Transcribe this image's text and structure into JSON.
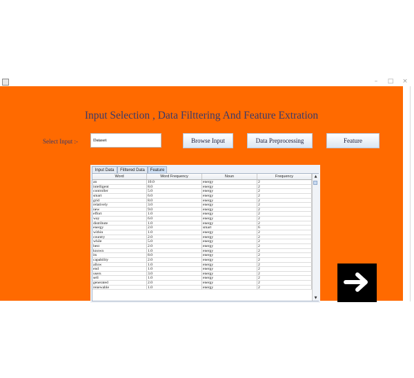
{
  "window": {
    "minimize": "–",
    "maximize": "□",
    "close": "×"
  },
  "heading": "Input Selection , Data Filttering And Feature Extration",
  "select_label": "Select Input  :-",
  "dataset_value": "Dataset",
  "buttons": {
    "browse": "Browse Input",
    "preprocess": "Data Preprocessing",
    "feature": "Feature"
  },
  "tabs": [
    "Input Data",
    "Filltered Data",
    "Feature"
  ],
  "table": {
    "columns": [
      "Word",
      "Word Frequency",
      "Noun",
      "Frequency"
    ],
    "rows": [
      [
        "an",
        "10.0",
        "energy",
        "2"
      ],
      [
        "intelligent",
        "8.0",
        "energy",
        "2"
      ],
      [
        "controller",
        "5.0",
        "energy",
        "2"
      ],
      [
        "smart",
        "6.0",
        "energy",
        "2"
      ],
      [
        "grid",
        "8.0",
        "energy",
        "2"
      ],
      [
        "relatively",
        "3.0",
        "energy",
        "2"
      ],
      [
        "new",
        "9.0",
        "energy",
        "2"
      ],
      [
        "effort",
        "1.0",
        "energy",
        "2"
      ],
      [
        "way",
        "6.0",
        "energy",
        "2"
      ],
      [
        "distribute",
        "1.0",
        "energy",
        "2"
      ],
      [
        "energy",
        "2.0",
        "smart",
        "6"
      ],
      [
        "within",
        "1.0",
        "energy",
        "2"
      ],
      [
        "country",
        "2.0",
        "energy",
        "2"
      ],
      [
        "while",
        "5.0",
        "energy",
        "2"
      ],
      [
        "best",
        "2.0",
        "energy",
        "2"
      ],
      [
        "known",
        "1.0",
        "energy",
        "2"
      ],
      [
        "its",
        "8.0",
        "energy",
        "2"
      ],
      [
        "capability",
        "2.0",
        "energy",
        "2"
      ],
      [
        "allow",
        "1.0",
        "energy",
        "2"
      ],
      [
        "end",
        "1.0",
        "energy",
        "2"
      ],
      [
        "users",
        "3.0",
        "energy",
        "2"
      ],
      [
        "sell",
        "1.0",
        "energy",
        "2"
      ],
      [
        "generated",
        "2.0",
        "energy",
        "2"
      ],
      [
        "renewable",
        "1.0",
        "energy",
        "2"
      ]
    ]
  },
  "icons": {
    "next": "right-arrow-icon",
    "app": "java-app-icon"
  },
  "colors": {
    "background": "#ff6a00",
    "heading": "#3a3a6a",
    "next_button": "#000000"
  }
}
